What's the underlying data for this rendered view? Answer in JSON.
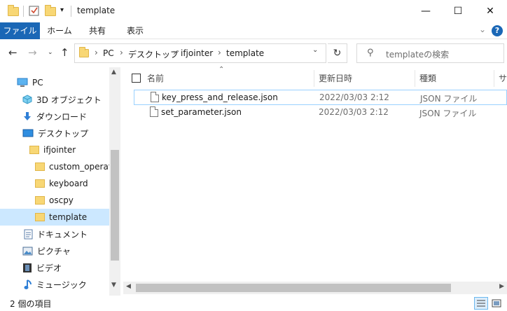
{
  "window": {
    "title": "template",
    "minimize": "—",
    "maximize": "☐",
    "close": "✕"
  },
  "ribbon": {
    "tabs": [
      "ファイル",
      "ホーム",
      "共有",
      "表示"
    ],
    "help": "?",
    "collapse": "⌄"
  },
  "address": {
    "crumbs": [
      "PC",
      "デスクトップ",
      "ifjointer",
      "template"
    ],
    "search_placeholder": "templateの検索"
  },
  "nav": {
    "items": [
      {
        "label": "PC",
        "icon": "pc-icon"
      },
      {
        "label": "3D オブジェクト",
        "icon": "3d-objects-icon"
      },
      {
        "label": "ダウンロード",
        "icon": "download-icon"
      },
      {
        "label": "デスクトップ",
        "icon": "desktop-icon"
      },
      {
        "label": "ifjointer",
        "icon": "folder-icon"
      },
      {
        "label": "custom_operato",
        "icon": "folder-icon"
      },
      {
        "label": "keyboard",
        "icon": "folder-icon"
      },
      {
        "label": "oscpy",
        "icon": "folder-icon"
      },
      {
        "label": "template",
        "icon": "folder-icon",
        "selected": true
      },
      {
        "label": "ドキュメント",
        "icon": "documents-icon"
      },
      {
        "label": "ピクチャ",
        "icon": "pictures-icon"
      },
      {
        "label": "ビデオ",
        "icon": "video-icon"
      },
      {
        "label": "ミュージック",
        "icon": "music-icon"
      }
    ]
  },
  "columns": {
    "name": "名前",
    "date": "更新日時",
    "type": "種類",
    "size": "サ"
  },
  "files": [
    {
      "name": "key_press_and_release.json",
      "date": "2022/03/03 2:12",
      "type": "JSON ファイル"
    },
    {
      "name": "set_parameter.json",
      "date": "2022/03/03 2:12",
      "type": "JSON ファイル"
    }
  ],
  "status": {
    "count": "2 個の項目"
  }
}
